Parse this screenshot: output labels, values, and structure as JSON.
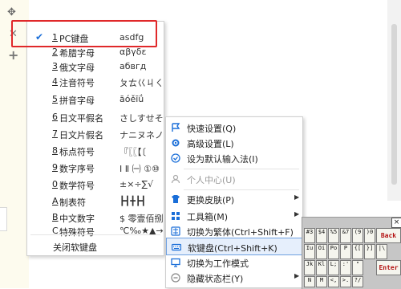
{
  "soft_keyboard_menu": {
    "items": [
      {
        "num": "1",
        "label": "PC键盘",
        "sample": "asdfg",
        "checked": true
      },
      {
        "num": "2",
        "label": "希腊字母",
        "sample": "αβγδε"
      },
      {
        "num": "3",
        "label": "俄文字母",
        "sample": "абвгд"
      },
      {
        "num": "4",
        "label": "注音符号",
        "sample": "ㄆㄊ巜ㄐㄑ"
      },
      {
        "num": "5",
        "label": "拼音字母",
        "sample": "āóěīǘ"
      },
      {
        "num": "6",
        "label": "日文平假名",
        "sample": "さしすせそ"
      },
      {
        "num": "7",
        "label": "日文片假名",
        "sample": "ナニヌネノ"
      },
      {
        "num": "8",
        "label": "标点符号",
        "sample": "『〖〖【〔"
      },
      {
        "num": "9",
        "label": "数字序号",
        "sample": "Ⅰ Ⅱ ㈠ ①⑩"
      },
      {
        "num": "0",
        "label": "数学符号",
        "sample": "±×÷∑√"
      },
      {
        "num": "A",
        "label": "制表符",
        "sample": "┣┫╋┣┫"
      },
      {
        "num": "B",
        "label": "中文数字",
        "sample": "$ 零壹佰捌"
      },
      {
        "num": "C",
        "label": "特殊符号",
        "sample": "℃‰★▲→"
      }
    ],
    "close_label": "关闭软键盘"
  },
  "context_menu": {
    "items": [
      {
        "label": "快速设置(Q)",
        "icon": "flag-icon"
      },
      {
        "label": "高级设置(L)",
        "icon": "gear-icon"
      },
      {
        "label": "设为默认输入法(I)",
        "icon": "check-circle-icon"
      },
      {
        "label": "个人中心(U)",
        "icon": "user-icon",
        "disabled": true
      },
      {
        "label": "更换皮肤(P)",
        "icon": "tshirt-icon",
        "submenu": true
      },
      {
        "label": "工具箱(M)",
        "icon": "grid-icon",
        "submenu": true
      },
      {
        "label": "切换为繁体(Ctrl+Shift+F)",
        "icon": "trad-chinese-icon"
      },
      {
        "label": "软键盘(Ctrl+Shift+K)",
        "icon": "keyboard-icon",
        "highlighted": true
      },
      {
        "label": "切换为工作模式",
        "icon": "monitor-icon"
      },
      {
        "label": "隐藏状态栏(Y)",
        "icon": "minus-circle-icon",
        "submenu": true
      }
    ]
  },
  "virtual_keyboard": {
    "close": "×",
    "row1": [
      "#3",
      "$4",
      "%5",
      "&7",
      "(9",
      ")0",
      "-",
      "+="
    ],
    "backspace": "Back",
    "row2": [
      "Iu",
      "Oi",
      "Po",
      "P",
      "{[",
      "}]",
      "|\\"
    ],
    "row3": [
      "Jk",
      "Kl",
      "L;",
      ":'",
      "\""
    ],
    "enter": "Enter",
    "row4": [
      "N",
      "M",
      "<,",
      ">.",
      "?/"
    ]
  },
  "colors": {
    "accent": "#1a6ed8",
    "highlight": "#e6effc",
    "annotation": "#e0282a"
  }
}
